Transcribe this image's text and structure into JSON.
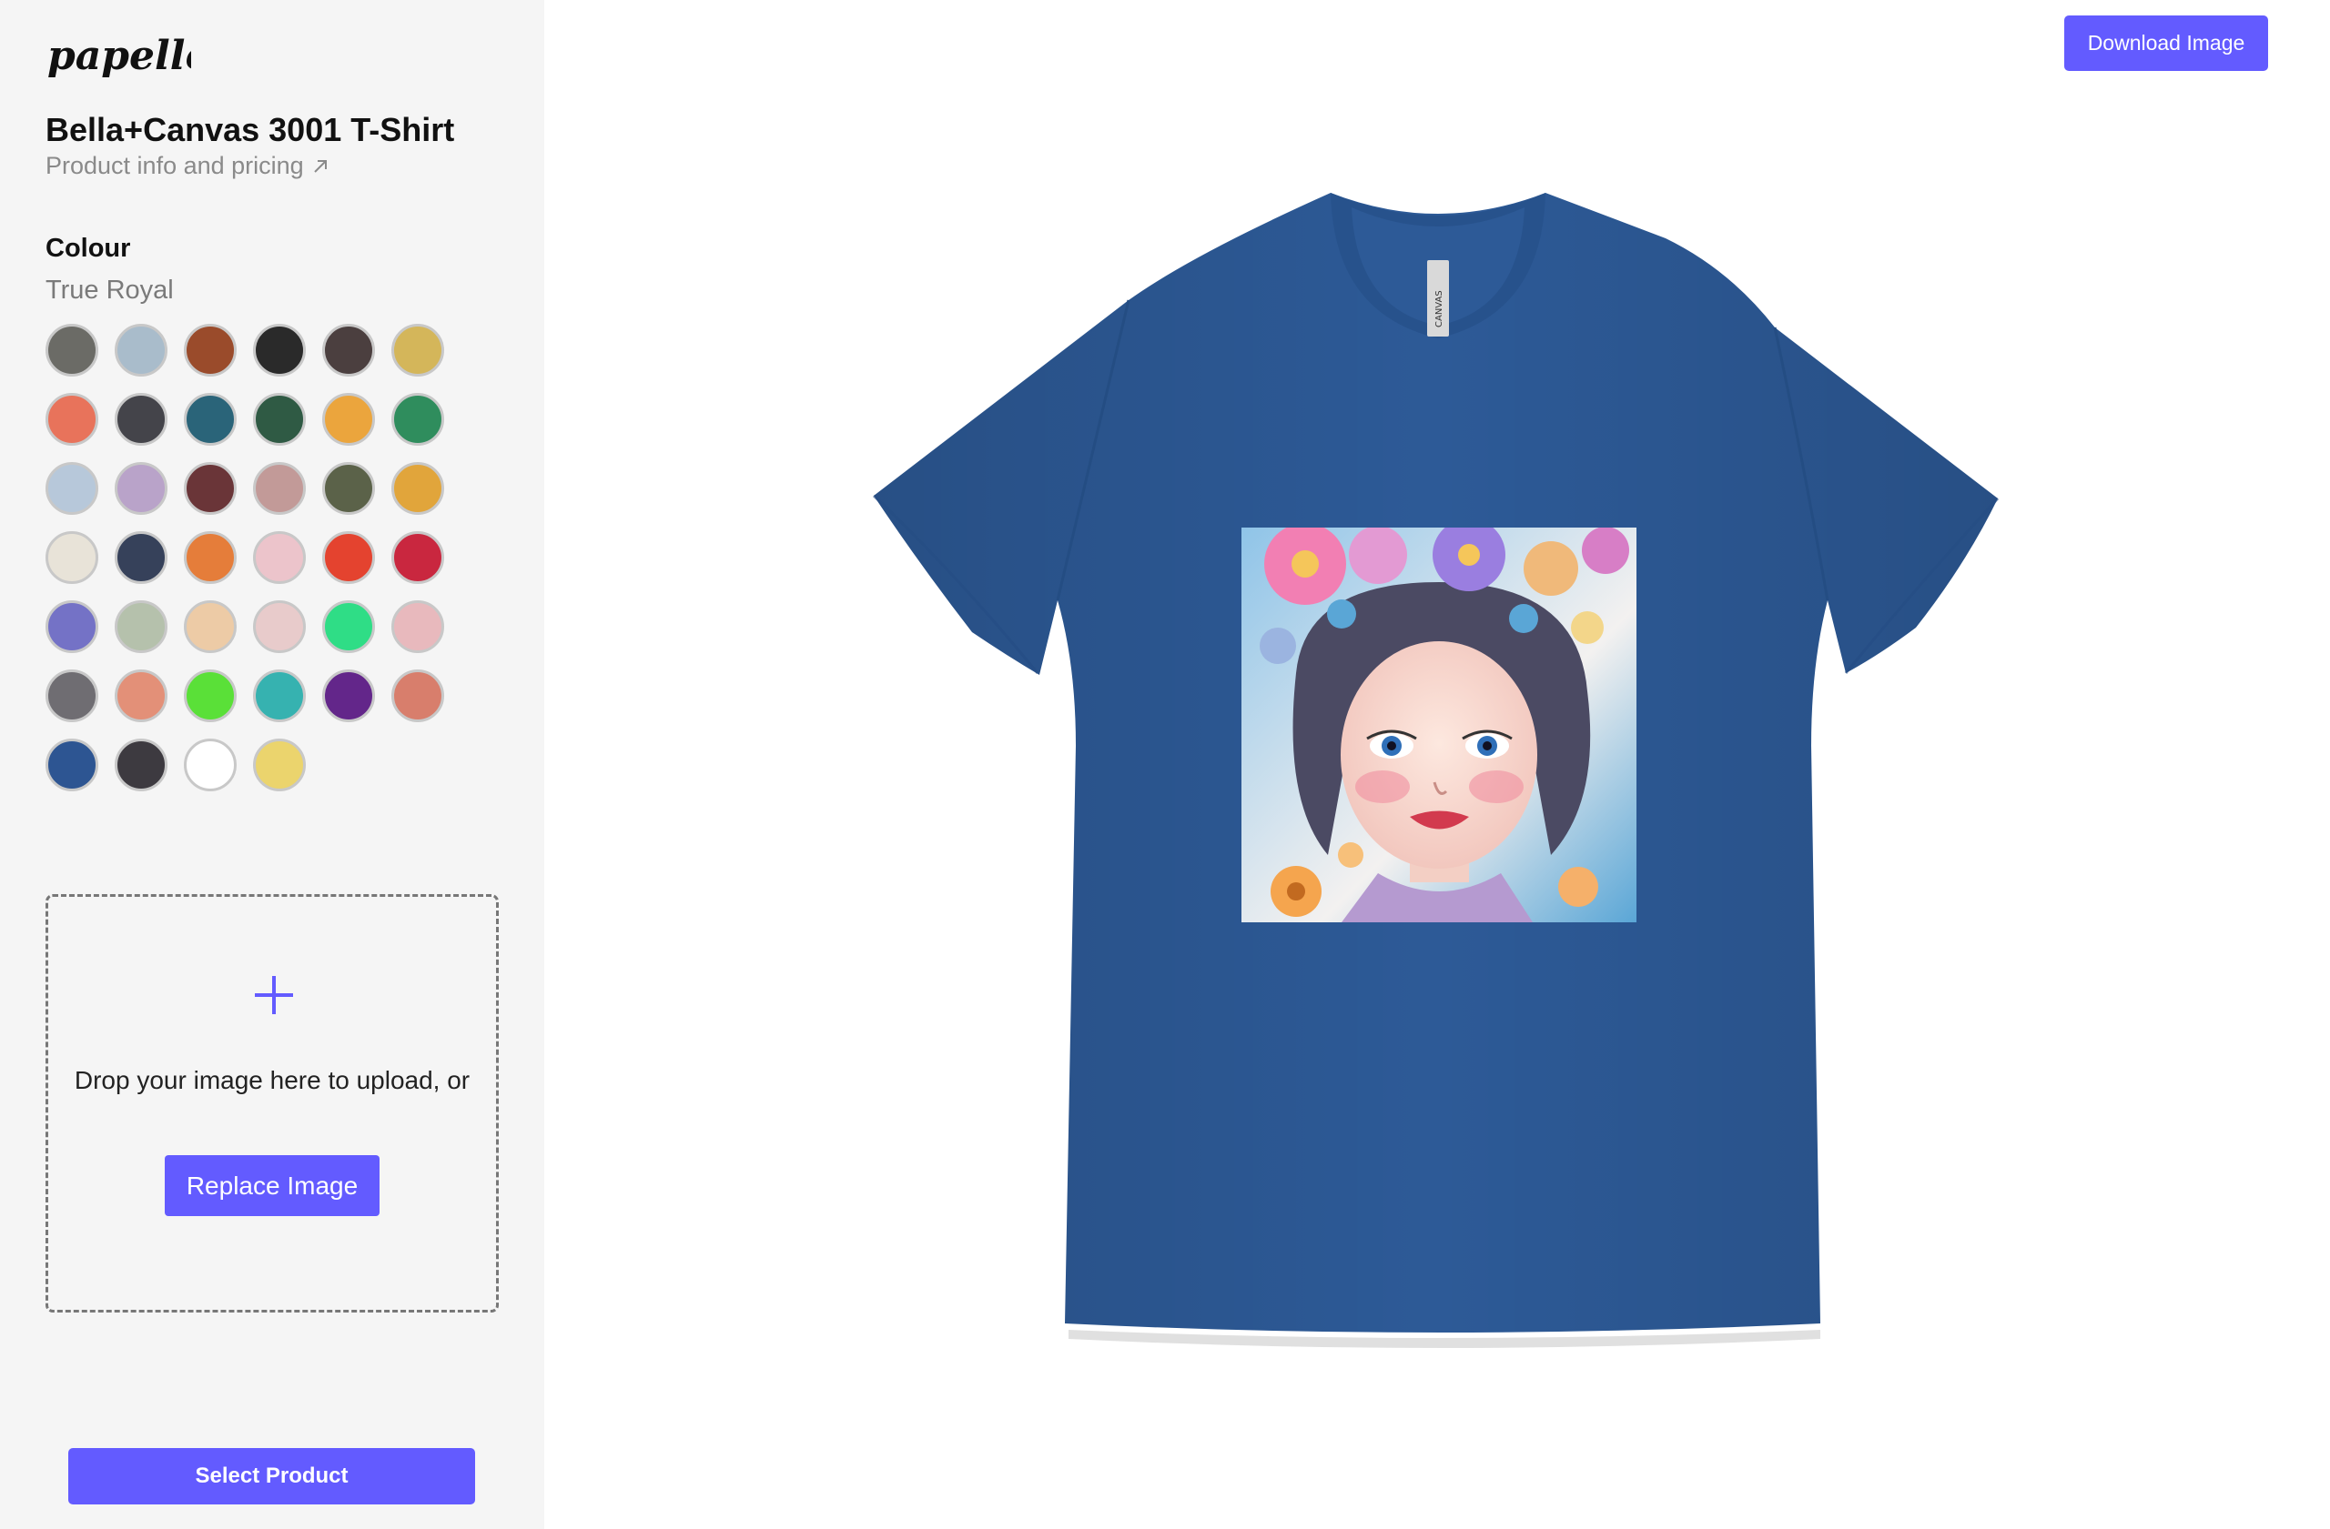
{
  "sidebar": {
    "logo_text": "papello",
    "product_title": "Bella+Canvas 3001 T-Shirt",
    "product_link": "Product info and pricing",
    "colour_heading": "Colour",
    "selected_colour": "True Royal",
    "swatches": [
      "#6b6b66",
      "#a9bccb",
      "#9a4b2b",
      "#2a2a2a",
      "#4b3f3f",
      "#d4b65a",
      "#e8735b",
      "#44444a",
      "#2a6479",
      "#2f5a44",
      "#eba53d",
      "#2f8d5d",
      "#b7c8da",
      "#b9a3c9",
      "#6a3538",
      "#c29a98",
      "#5b6249",
      "#e1a53b",
      "#e8e3d8",
      "#36415a",
      "#e57d3a",
      "#ecc4cb",
      "#e4432f",
      "#c9273f",
      "#7472c6",
      "#b5c1ac",
      "#edcba6",
      "#e8cbcb",
      "#2fdd86",
      "#e8b9bd",
      "#6f6d72",
      "#e39078",
      "#5ae038",
      "#36b2b0",
      "#63268a",
      "#d87e6c",
      "#2d5592",
      "#3d3a40",
      "#ffffff",
      "#ebd46d"
    ],
    "dropzone": {
      "text": "Drop your image here to upload, or",
      "replace_label": "Replace Image"
    },
    "select_label": "Select Product"
  },
  "header": {
    "download_label": "Download Image"
  },
  "preview": {
    "shirt_colour": "#2d5a97",
    "neck_label": "CANVAS"
  },
  "colors": {
    "accent": "#635bff",
    "sidebar_bg": "#f5f5f5"
  }
}
